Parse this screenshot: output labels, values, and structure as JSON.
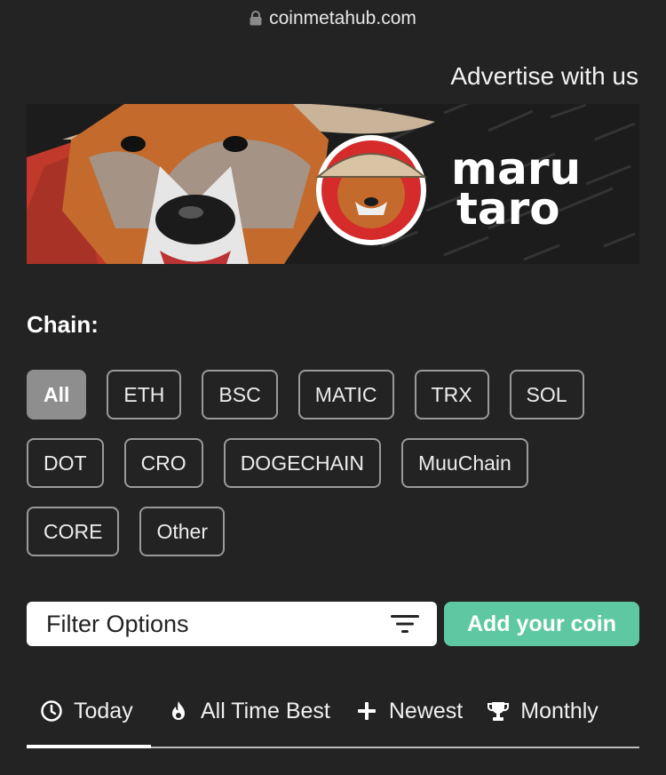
{
  "browser": {
    "url": "coinmetahub.com"
  },
  "header": {
    "advertise_label": "Advertise with us"
  },
  "banner": {
    "brand_line1": "maru",
    "brand_line2": "taro"
  },
  "chain": {
    "label": "Chain:",
    "chips": [
      "All",
      "ETH",
      "BSC",
      "MATIC",
      "TRX",
      "SOL",
      "DOT",
      "CRO",
      "DOGECHAIN",
      "MuuChain",
      "CORE",
      "Other"
    ],
    "selected": "All"
  },
  "controls": {
    "filter_label": "Filter Options",
    "add_coin_label": "Add your coin"
  },
  "tabs": [
    {
      "label": "Today",
      "icon": "clock-icon"
    },
    {
      "label": "All Time Best",
      "icon": "flame-icon"
    },
    {
      "label": "Newest",
      "icon": "plus-icon"
    },
    {
      "label": "Monthly",
      "icon": "trophy-icon"
    }
  ],
  "colors": {
    "background": "#232323",
    "accent": "#5ec8a2",
    "chip_active": "#8e8e8e"
  }
}
